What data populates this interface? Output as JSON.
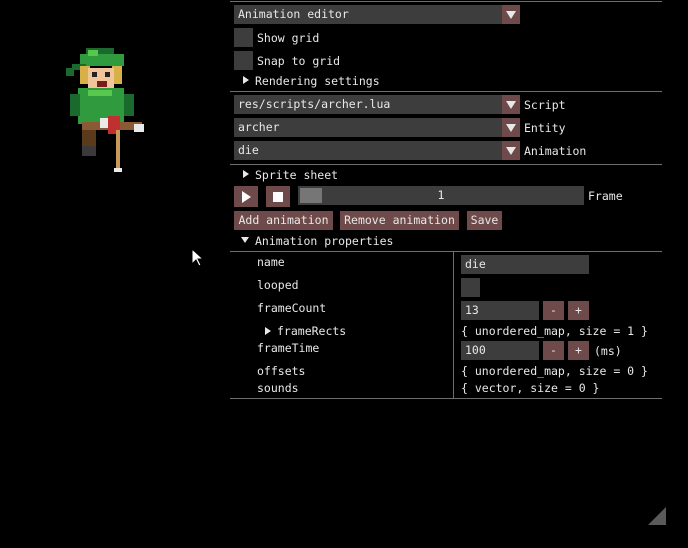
{
  "editor": {
    "mode_value": "Animation editor",
    "show_grid_label": "Show grid",
    "snap_to_grid_label": "Snap to grid",
    "rendering_settings_label": "Rendering settings",
    "script_value": "res/scripts/archer.lua",
    "script_label": "Script",
    "entity_value": "archer",
    "entity_label": "Entity",
    "animation_value": "die",
    "animation_label": "Animation",
    "sprite_sheet_label": "Sprite sheet",
    "frame_value": "1",
    "frame_slider_fraction": 0.0,
    "frame_label": "Frame",
    "add_animation_label": "Add animation",
    "remove_animation_label": "Remove animation",
    "save_label": "Save",
    "animation_properties_label": "Animation properties"
  },
  "properties": {
    "name_key": "name",
    "name_value": "die",
    "looped_key": "looped",
    "frameCount_key": "frameCount",
    "frameCount_value": "13",
    "frameRects_key": "frameRects",
    "frameRects_value": "{ unordered_map, size = 1 }",
    "frameTime_key": "frameTime",
    "frameTime_value": "100",
    "frameTime_unit": "(ms)",
    "offsets_key": "offsets",
    "offsets_value": "{ unordered_map, size = 0 }",
    "sounds_key": "sounds",
    "sounds_value": "{ vector, size = 0 }",
    "minus_label": "-",
    "plus_label": "+"
  },
  "colors": {
    "accent": "#6e4a4a",
    "field": "#3d3d3d",
    "separator": "#6e6e6e",
    "background": "#000000"
  },
  "icons": {
    "play": "play-icon",
    "stop": "stop-icon",
    "cursor": "mouse-cursor-icon",
    "resize": "resize-grip-icon",
    "sprite": "archer-sprite"
  }
}
